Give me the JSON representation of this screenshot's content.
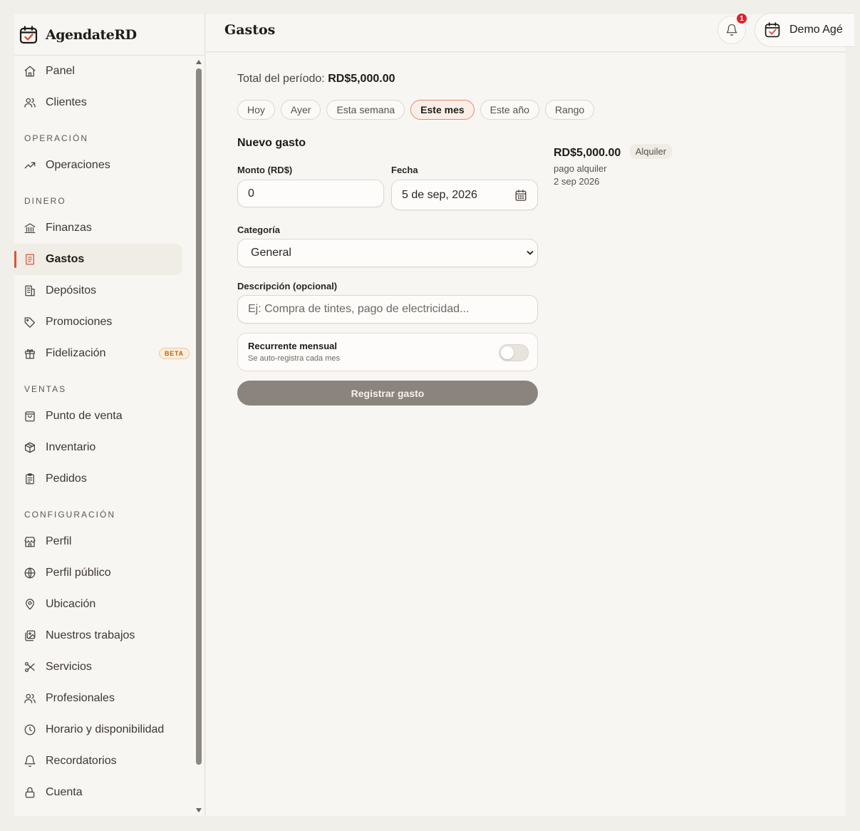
{
  "brand": {
    "name": "AgendateRD"
  },
  "header": {
    "title": "Gastos",
    "notification_count": "1",
    "account_name": "Demo Agé"
  },
  "sidebar": {
    "items": [
      {
        "type": "item",
        "label": "Panel",
        "icon": "home-icon"
      },
      {
        "type": "item",
        "label": "Clientes",
        "icon": "users-icon"
      },
      {
        "type": "section",
        "label": "OPERACIÓN"
      },
      {
        "type": "item",
        "label": "Operaciones",
        "icon": "trending-icon"
      },
      {
        "type": "section",
        "label": "DINERO"
      },
      {
        "type": "item",
        "label": "Finanzas",
        "icon": "bank-icon"
      },
      {
        "type": "item",
        "label": "Gastos",
        "icon": "receipt-icon",
        "active": true
      },
      {
        "type": "item",
        "label": "Depósitos",
        "icon": "building-icon"
      },
      {
        "type": "item",
        "label": "Promociones",
        "icon": "tag-icon"
      },
      {
        "type": "item",
        "label": "Fidelización",
        "icon": "gift-icon",
        "badge": "BETA"
      },
      {
        "type": "section",
        "label": "VENTAS"
      },
      {
        "type": "item",
        "label": "Punto de venta",
        "icon": "bag-icon"
      },
      {
        "type": "item",
        "label": "Inventario",
        "icon": "box-icon"
      },
      {
        "type": "item",
        "label": "Pedidos",
        "icon": "clipboard-icon"
      },
      {
        "type": "section",
        "label": "CONFIGURACIÓN"
      },
      {
        "type": "item",
        "label": "Perfil",
        "icon": "store-icon"
      },
      {
        "type": "item",
        "label": "Perfil público",
        "icon": "globe-icon"
      },
      {
        "type": "item",
        "label": "Ubicación",
        "icon": "map-pin-icon"
      },
      {
        "type": "item",
        "label": "Nuestros trabajos",
        "icon": "images-icon"
      },
      {
        "type": "item",
        "label": "Servicios",
        "icon": "scissors-icon"
      },
      {
        "type": "item",
        "label": "Profesionales",
        "icon": "users-icon"
      },
      {
        "type": "item",
        "label": "Horario y disponibilidad",
        "icon": "clock-icon"
      },
      {
        "type": "item",
        "label": "Recordatorios",
        "icon": "bell-icon"
      },
      {
        "type": "item",
        "label": "Cuenta",
        "icon": "lock-icon"
      }
    ]
  },
  "main": {
    "total_label": "Total del período:",
    "total_value": "RD$5,000.00",
    "periods": [
      {
        "label": "Hoy"
      },
      {
        "label": "Ayer"
      },
      {
        "label": "Esta semana"
      },
      {
        "label": "Este mes",
        "active": true
      },
      {
        "label": "Este año"
      },
      {
        "label": "Rango"
      }
    ],
    "form": {
      "title": "Nuevo gasto",
      "amount_label": "Monto (RD$)",
      "amount_value": "0",
      "date_label": "Fecha",
      "date_value": "5 de sep, 2026",
      "category_label": "Categoría",
      "category_value": "General",
      "description_label": "Descripción (opcional)",
      "description_placeholder": "Ej: Compra de tintes, pago de electricidad...",
      "recurring_title": "Recurrente mensual",
      "recurring_subtitle": "Se auto-registra cada mes",
      "submit_label": "Registrar gasto"
    },
    "expenses": [
      {
        "amount": "RD$5,000.00",
        "category": "Alquiler",
        "description": "pago alquiler",
        "date": "2 sep 2026"
      }
    ]
  },
  "colors": {
    "accent": "#d9543b",
    "background": "#f8f6f2",
    "submit": "#8b837e"
  }
}
